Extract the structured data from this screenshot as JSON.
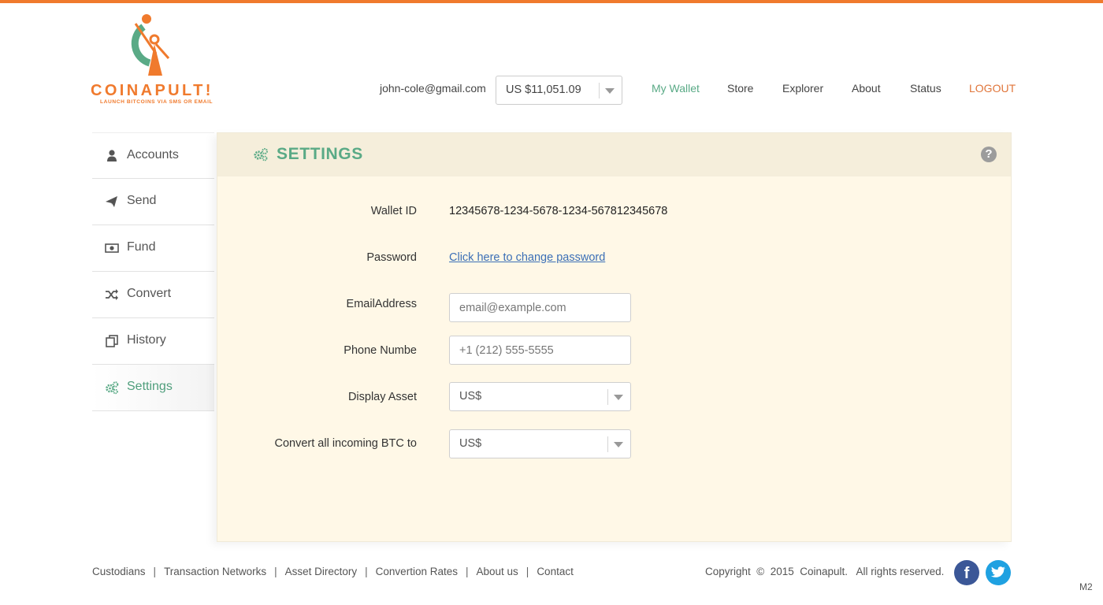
{
  "brand": {
    "name": "COINAPULT!",
    "tagline": "LAUNCH BITCOINS VIA SMS OR EMAIL",
    "accent_color": "#f07a2d",
    "green_color": "#5aaa86"
  },
  "header": {
    "user_email": "john-cole@gmail.com",
    "balance": "US $11,051.09",
    "nav": [
      {
        "label": "My Wallet",
        "active": true
      },
      {
        "label": "Store"
      },
      {
        "label": "Explorer"
      },
      {
        "label": "About"
      },
      {
        "label": "Status"
      },
      {
        "label": "LOGOUT"
      }
    ]
  },
  "sidebar": {
    "items": [
      {
        "label": "Accounts",
        "icon": "user-icon"
      },
      {
        "label": "Send",
        "icon": "paper-plane-icon"
      },
      {
        "label": "Fund",
        "icon": "money-icon"
      },
      {
        "label": "Convert",
        "icon": "shuffle-icon"
      },
      {
        "label": "History",
        "icon": "copy-icon"
      },
      {
        "label": "Settings",
        "icon": "gears-icon",
        "active": true
      }
    ]
  },
  "settings": {
    "title": "SETTINGS",
    "help": "?",
    "wallet_id_label": "Wallet ID",
    "wallet_id_value": "12345678-1234-5678-1234-567812345678",
    "password_label": "Password",
    "password_link": "Click here to change password",
    "email_label": "EmailAddress",
    "email_placeholder": "email@example.com",
    "phone_label": "Phone Numbe",
    "phone_placeholder": "+1 (212) 555-5555",
    "display_asset_label": "Display Asset",
    "display_asset_value": "US$",
    "convert_label": "Convert all incoming BTC to",
    "convert_value": "US$"
  },
  "footer": {
    "links": [
      "Custodians",
      "Transaction Networks",
      "Asset Directory",
      "Convertion Rates",
      "About us",
      "Contact"
    ],
    "separator": "|",
    "copyright": "Copyright  ©  2015  Coinapult.   All rights reserved.",
    "facebook": "f",
    "version": "M2"
  }
}
